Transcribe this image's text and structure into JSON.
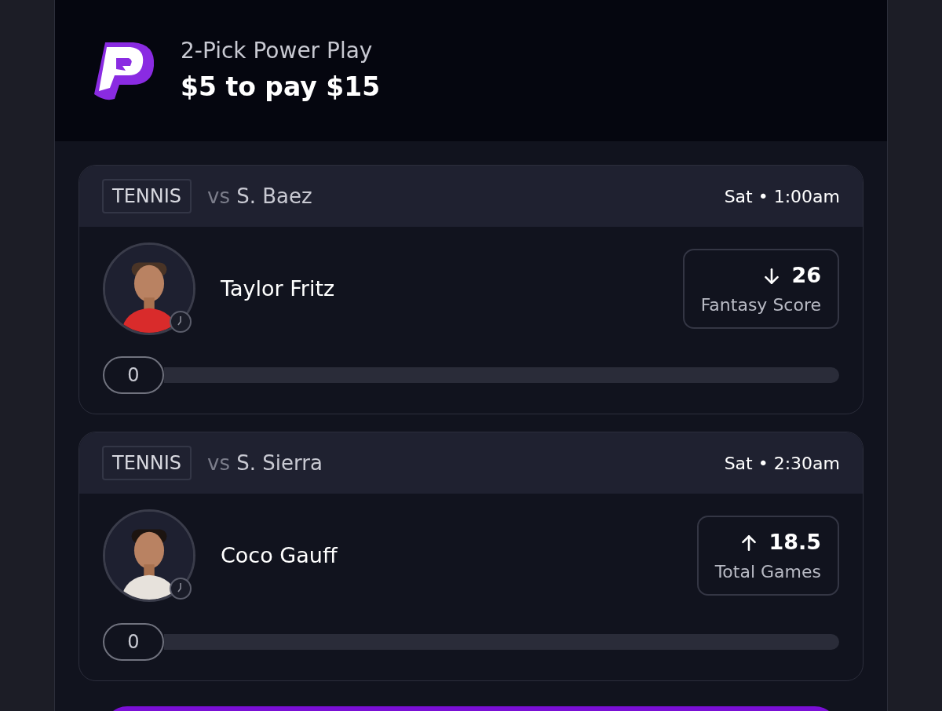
{
  "header": {
    "title": "2-Pick Power Play",
    "payout": "$5 to pay $15"
  },
  "picks": [
    {
      "sport": "TENNIS",
      "vs": "vs",
      "opponent": "S. Baez",
      "time": "Sat • 1:00am",
      "player": "Taylor Fritz",
      "kind": "under",
      "line": "26",
      "stat": "Fantasy Score",
      "progress": "0",
      "level": 0
    },
    {
      "sport": "TENNIS",
      "vs": "vs",
      "opponent": "S. Sierra",
      "time": "Sat • 2:30am",
      "player": "Coco Gauff",
      "kind": "over",
      "line": "18.5",
      "stat": "Total Games",
      "progress": "0",
      "level": 0
    }
  ]
}
